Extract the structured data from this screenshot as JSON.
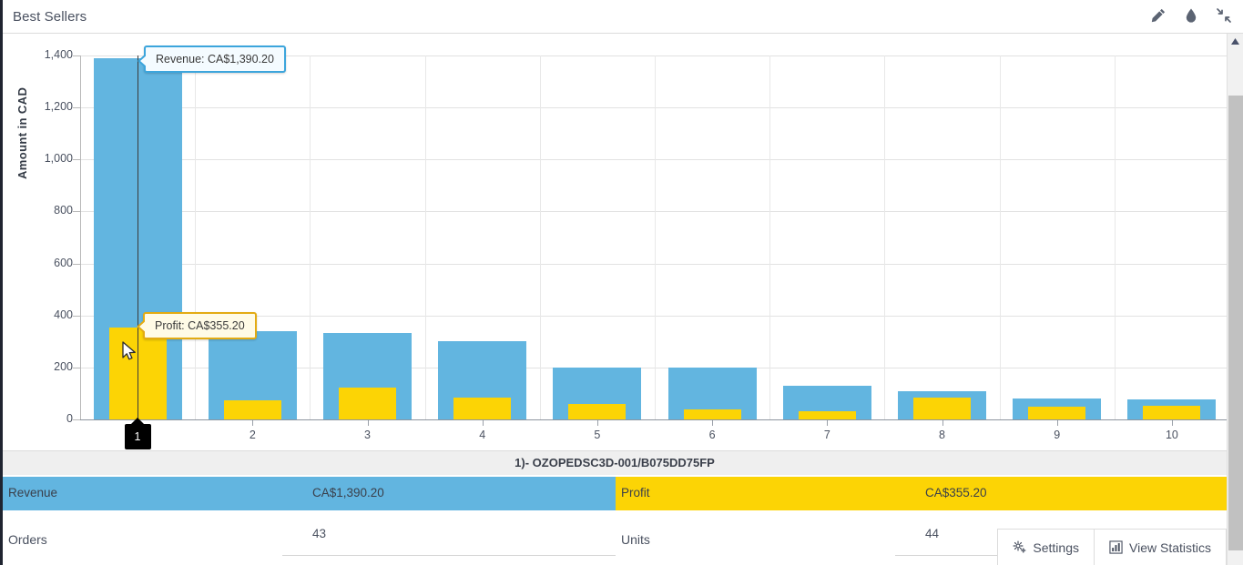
{
  "header": {
    "title": "Best Sellers",
    "icons": [
      {
        "name": "pencil-icon",
        "label": "Edit"
      },
      {
        "name": "droplet-icon",
        "label": "Theme"
      },
      {
        "name": "collapse-icon",
        "label": "Collapse"
      }
    ]
  },
  "chart_data": {
    "type": "bar",
    "title": "Best Sellers",
    "xlabel": "",
    "ylabel": "Amount in CAD",
    "categories": [
      "1",
      "2",
      "3",
      "4",
      "5",
      "6",
      "7",
      "8",
      "9",
      "10"
    ],
    "ylim": [
      0,
      1400
    ],
    "yticks": [
      "0",
      "200",
      "400",
      "600",
      "800",
      "1,000",
      "1,200",
      "1,400"
    ],
    "ytick_values": [
      0,
      200,
      400,
      600,
      800,
      1000,
      1200,
      1400
    ],
    "grid": true,
    "legend": "none",
    "series": [
      {
        "name": "Revenue",
        "color": "#62b5e0",
        "values": [
          1390.2,
          340,
          333,
          301,
          200,
          200,
          130,
          109,
          80,
          77
        ]
      },
      {
        "name": "Profit",
        "color": "#fcd405",
        "values": [
          355.2,
          74,
          123,
          84,
          60,
          38,
          32,
          84,
          49,
          53
        ]
      }
    ],
    "selected_category": "1",
    "annotations": [
      {
        "name": "revenue-tooltip",
        "text": "Revenue: CA$1,390.20"
      },
      {
        "name": "profit-tooltip",
        "text": "Profit: CA$355.20"
      }
    ]
  },
  "detail": {
    "sku": "1)- OZOPEDSC3D-001/B075DD75FP",
    "revenue_label": "Revenue",
    "revenue_value": "CA$1,390.20",
    "profit_label": "Profit",
    "profit_value": "CA$355.20",
    "orders_label": "Orders",
    "orders_value": "43",
    "units_label": "Units",
    "units_value": "44"
  },
  "footer": {
    "settings_label": "Settings",
    "statistics_label": "View Statistics"
  },
  "colors": {
    "revenue": "#62b5e0",
    "profit": "#fcd405",
    "selected_marker": "#000000"
  }
}
